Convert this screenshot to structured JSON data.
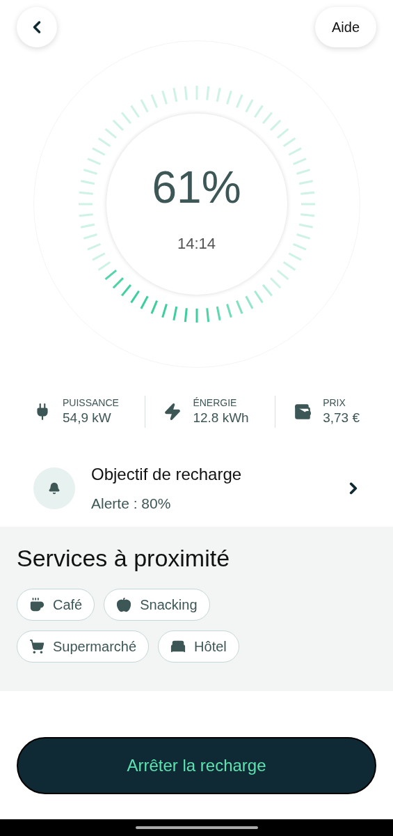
{
  "header": {
    "help_button": "Aide"
  },
  "gauge": {
    "percent": "61%",
    "time": "14:14"
  },
  "stats": [
    {
      "kind": "power",
      "label": "PUISSANCE",
      "value": "54,9 kW"
    },
    {
      "kind": "energy",
      "label": "ÉNERGIE",
      "value": "12.8 kWh"
    },
    {
      "kind": "price",
      "label": "PRIX",
      "value": "3,73 €"
    }
  ],
  "goal": {
    "title": "Objectif de recharge",
    "subtitle": "Alerte : 80%"
  },
  "services": {
    "title": "Services à proximité",
    "tags": [
      {
        "kind": "cafe",
        "label": "Café"
      },
      {
        "kind": "snack",
        "label": "Snacking"
      },
      {
        "kind": "market",
        "label": "Supermarché"
      },
      {
        "kind": "hotel",
        "label": "Hôtel"
      }
    ]
  },
  "stop_button": "Arrêter la recharge"
}
